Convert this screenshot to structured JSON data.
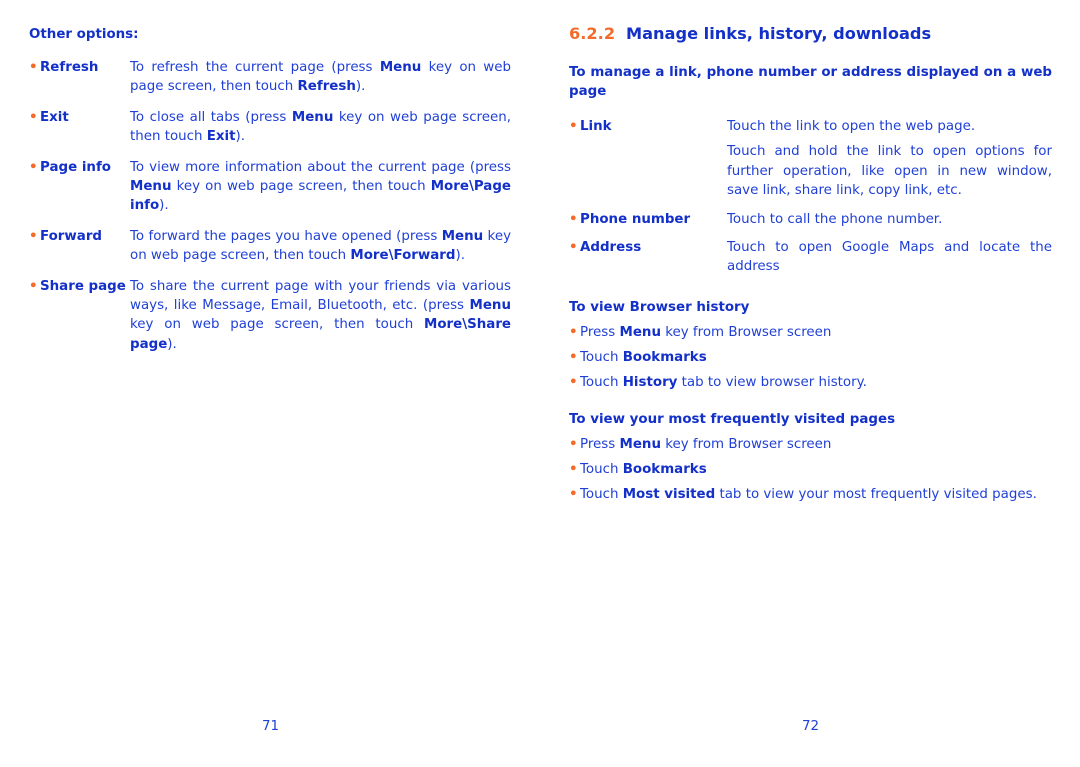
{
  "left_page": {
    "heading": "Other options:",
    "items": [
      {
        "term": "Refresh",
        "desc": [
          {
            "t": "To refresh the current page (press "
          },
          {
            "b": "Menu"
          },
          {
            "t": " key on web page screen, then touch "
          },
          {
            "b": "Refresh"
          },
          {
            "t": ")."
          }
        ]
      },
      {
        "term": "Exit",
        "desc": [
          {
            "t": "To close all tabs (press "
          },
          {
            "b": "Menu"
          },
          {
            "t": " key on web page screen, then touch "
          },
          {
            "b": "Exit"
          },
          {
            "t": ")."
          }
        ]
      },
      {
        "term": "Page info",
        "desc": [
          {
            "t": "To view more information about the current page (press "
          },
          {
            "b": "Menu"
          },
          {
            "t": " key on web page screen, then touch "
          },
          {
            "b": "More\\Page info"
          },
          {
            "t": ")."
          }
        ]
      },
      {
        "term": "Forward",
        "desc": [
          {
            "t": "To forward the pages you have opened (press "
          },
          {
            "b": "Menu"
          },
          {
            "t": " key on web page screen, then touch "
          },
          {
            "b": "More\\Forward"
          },
          {
            "t": ")."
          }
        ]
      },
      {
        "term": "Share page",
        "desc": [
          {
            "t": "To share the current page with your friends via various ways, like Message, Email, Bluetooth, etc. (press "
          },
          {
            "b": "Menu"
          },
          {
            "t": " key on web page screen, then touch "
          },
          {
            "b": "More\\Share page"
          },
          {
            "t": ")."
          }
        ]
      }
    ],
    "page_number": "71"
  },
  "right_page": {
    "section_number": "6.2.2",
    "section_title": "Manage links, history, downloads",
    "manage_heading": "To manage a link, phone number or address displayed on a web page",
    "manage_items": [
      {
        "term": "Link",
        "paras": [
          "Touch the link to open the web page.",
          "Touch and hold the link to open options for further operation, like open in new window, save link, share link, copy link, etc."
        ]
      },
      {
        "term": "Phone number",
        "paras": [
          "Touch to call the phone number."
        ]
      },
      {
        "term": "Address",
        "paras": [
          "Touch to open Google Maps and locate the address"
        ]
      }
    ],
    "history_heading": "To view Browser history",
    "history_steps": [
      [
        {
          "t": "Press "
        },
        {
          "b": "Menu"
        },
        {
          "t": " key from Browser screen"
        }
      ],
      [
        {
          "t": "Touch "
        },
        {
          "b": "Bookmarks"
        }
      ],
      [
        {
          "t": "Touch "
        },
        {
          "b": "History"
        },
        {
          "t": " tab to view browser history."
        }
      ]
    ],
    "visited_heading": "To view your most frequently visited pages",
    "visited_steps": [
      [
        {
          "t": "Press "
        },
        {
          "b": "Menu"
        },
        {
          "t": " key from Browser screen"
        }
      ],
      [
        {
          "t": "Touch "
        },
        {
          "b": "Bookmarks"
        }
      ],
      [
        {
          "t": "Touch "
        },
        {
          "b": "Most visited"
        },
        {
          "t": " tab to view your most frequently visited pages."
        }
      ]
    ],
    "page_number": "72"
  },
  "bullet_glyph": "•",
  "colors": {
    "text": "#1f3fd6",
    "bold": "#1330c8",
    "accent": "#f26b2a"
  }
}
